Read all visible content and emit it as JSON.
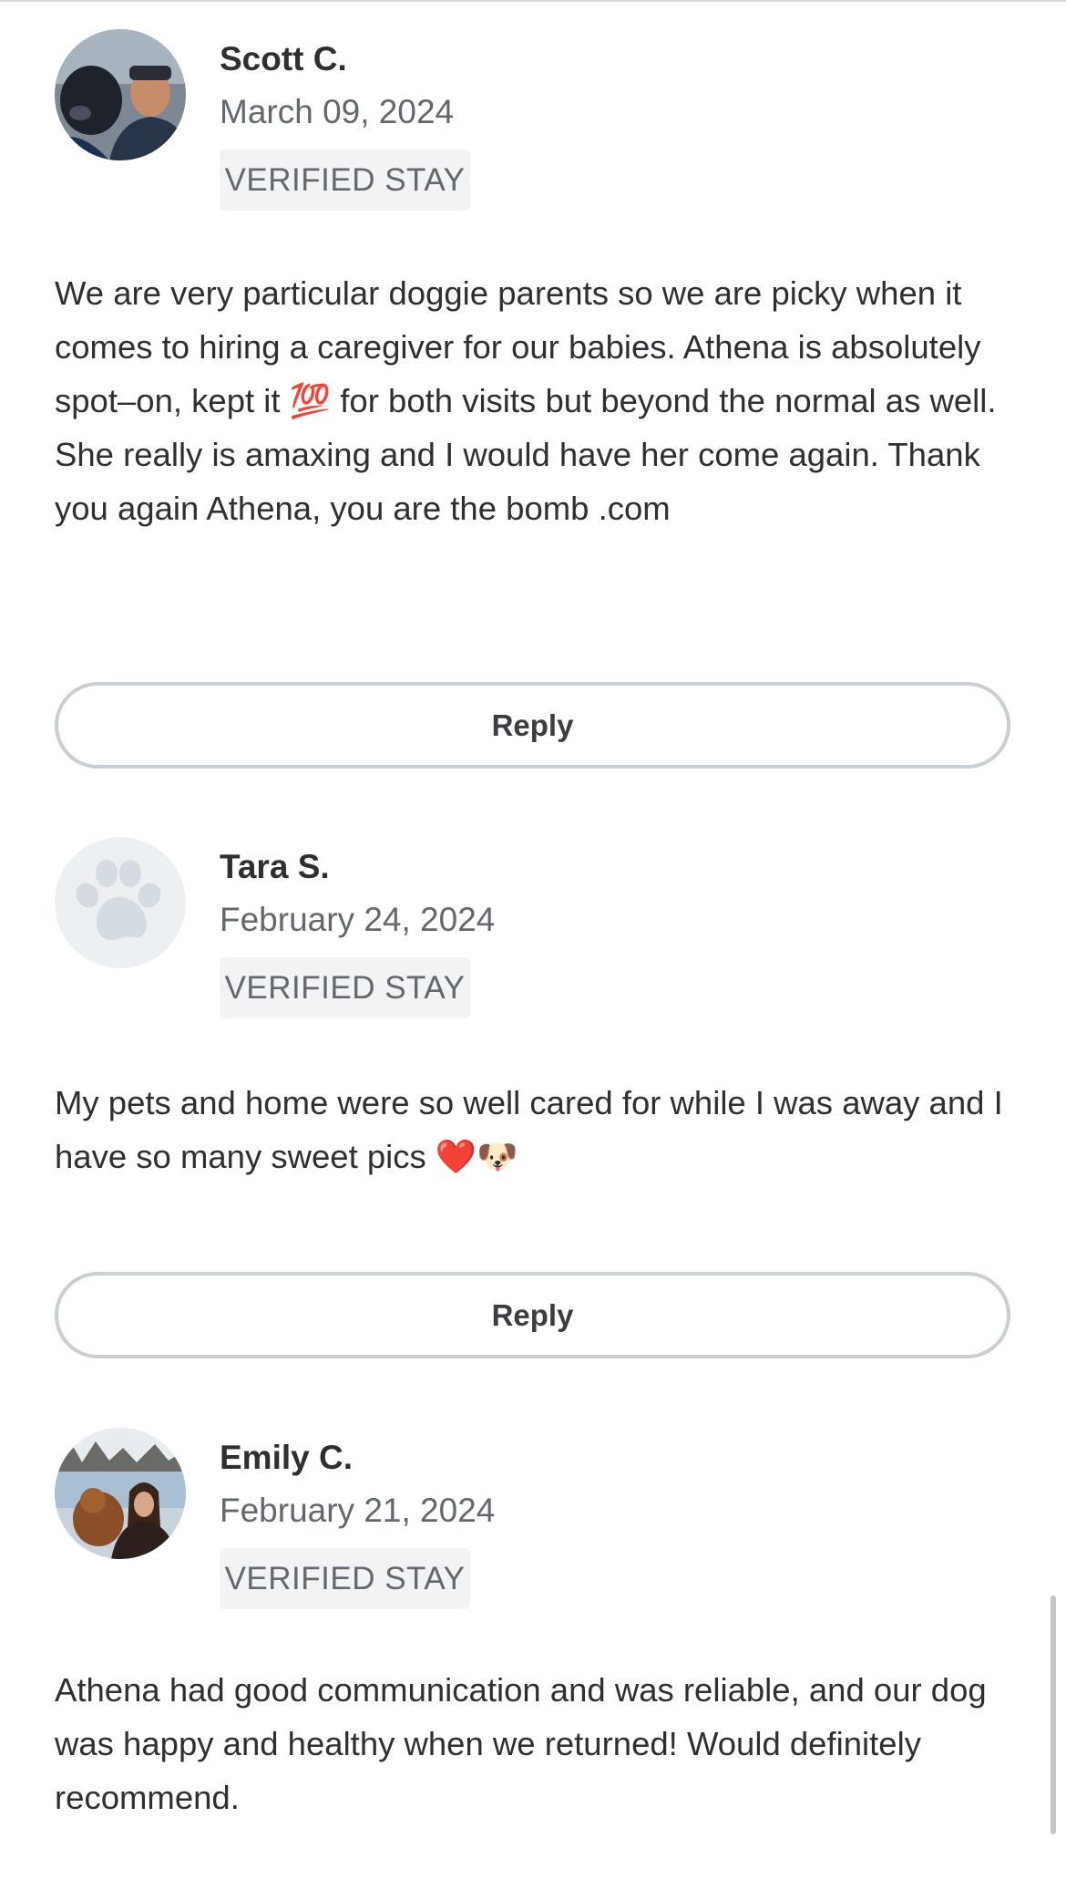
{
  "reviews": [
    {
      "name": "Scott C.",
      "date": "March 09, 2024",
      "badge": "VERIFIED STAY",
      "text": "We are very particular doggie parents so we are picky when it comes to hiring a caregiver for our babies. Athena is absolutely spot–on, kept it 💯 for both visits but beyond the normal as well. She really is amaxing and I would have her come again. Thank you again Athena, you are the bomb .com",
      "reply_label": "Reply",
      "avatar": "user-photo"
    },
    {
      "name": "Tara S.",
      "date": "February 24, 2024",
      "badge": "VERIFIED STAY",
      "text": "My pets and home were so well cared for while I was away and I have so many sweet pics ❤️🐶",
      "reply_label": "Reply",
      "avatar": "paw-icon"
    },
    {
      "name": "Emily C.",
      "date": "February 21, 2024",
      "badge": "VERIFIED STAY",
      "text": "Athena had good communication and was reliable, and our dog was happy and healthy when we returned! Would definitely recommend.",
      "avatar": "user-photo"
    }
  ],
  "colors": {
    "text": "#2d2f33",
    "muted": "#62686e",
    "badge_bg": "#f2f3f5",
    "button_border": "#c9ced3",
    "paw_bg": "#edf0f2",
    "paw_fg": "#d4dbe1"
  }
}
